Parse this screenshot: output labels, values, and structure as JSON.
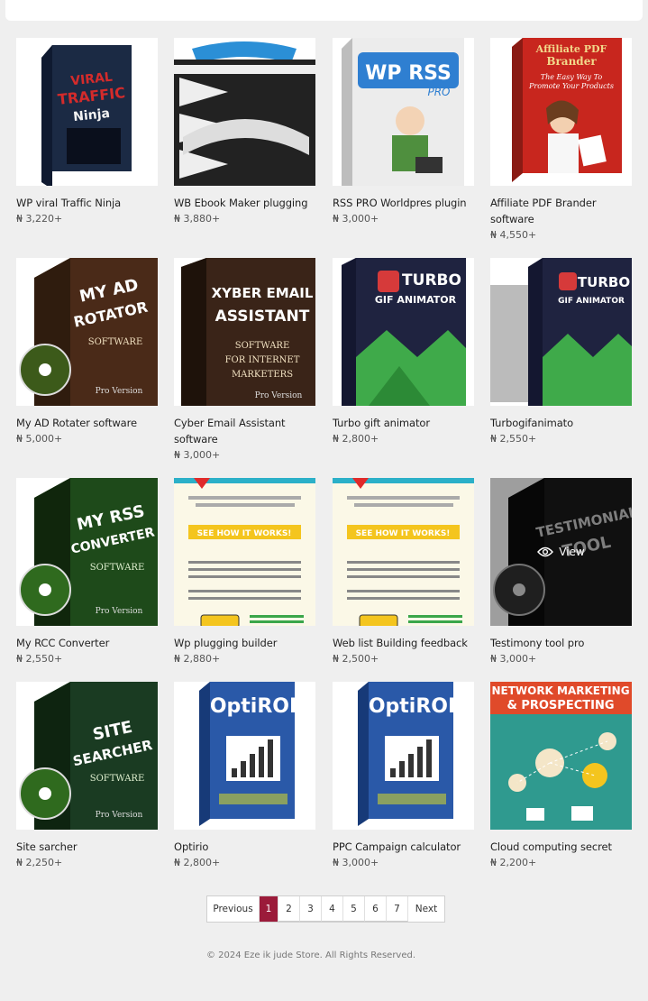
{
  "products": [
    {
      "title": "WP viral Traffic Ninja",
      "price": "₦ 3,220+",
      "cover_text": "VIRAL TRAFFIC Ninja",
      "cover_color": "#1b2a44",
      "accent": "#d42b2b"
    },
    {
      "title": "WB Ebook Maker plugging",
      "price": "₦ 3,880+",
      "cover_text": "",
      "cover_color": "#222222",
      "accent": "#2b8fd6"
    },
    {
      "title": "RSS PRO Worldpres plugin",
      "price": "₦ 3,000+",
      "cover_text": "WP RSS PRO",
      "cover_color": "#e8e8e8",
      "accent": "#2f7fd1"
    },
    {
      "title": "Affiliate PDF Brander software",
      "price": "₦ 4,550+",
      "cover_text": "Affiliate PDF Brander",
      "cover_color": "#c8261e",
      "accent": "#f2d98b"
    },
    {
      "title": "My AD Rotater software",
      "price": "₦ 5,000+",
      "cover_text": "MY AD ROTATOR",
      "cover_color": "#4a2a18",
      "accent": "#3c7a2a"
    },
    {
      "title": "Cyber Email Assistant software",
      "price": "₦ 3,000+",
      "cover_text": "XYBER EMAIL ASSISTANT",
      "cover_color": "#3a2418",
      "accent": "#f2f2f2"
    },
    {
      "title": "Turbo gift animator",
      "price": "₦ 2,800+",
      "cover_text": "TURBO GIF ANIMATOR",
      "cover_color": "#1f2340",
      "accent": "#3faa4a"
    },
    {
      "title": "Turbogifanimato",
      "price": "₦ 2,550+",
      "cover_text": "TURBO GIF ANIMATOR",
      "cover_color": "#1f2340",
      "accent": "#3faa4a"
    },
    {
      "title": "My RCC Converter",
      "price": "₦ 2,550+",
      "cover_text": "MY RSS CONVERTER",
      "cover_color": "#1e4a1a",
      "accent": "#66c23f"
    },
    {
      "title": "Wp plugging builder",
      "price": "₦ 2,880+",
      "cover_text": "SEE HOW IT WORKS!",
      "cover_color": "#fbf8e7",
      "accent": "#f4c51e"
    },
    {
      "title": "Web list Building feedback",
      "price": "₦ 2,500+",
      "cover_text": "SEE HOW IT WORKS!",
      "cover_color": "#fbf8e7",
      "accent": "#f4c51e"
    },
    {
      "title": "Testimony tool pro",
      "price": "₦ 3,000+",
      "cover_text": "TESTIMONIAL TOOL",
      "cover_color": "#1a1a1a",
      "accent": "#888888"
    },
    {
      "title": "Site sarcher",
      "price": "₦ 2,250+",
      "cover_text": "SITE SEARCHER",
      "cover_color": "#1a3b22",
      "accent": "#3b8a3e"
    },
    {
      "title": "Optirio",
      "price": "₦ 2,800+",
      "cover_text": "OptiROI",
      "cover_color": "#2a59a8",
      "accent": "#ffffff"
    },
    {
      "title": "PPC Campaign calculator",
      "price": "₦ 3,000+",
      "cover_text": "OptiROI",
      "cover_color": "#2a59a8",
      "accent": "#ffffff"
    },
    {
      "title": "Cloud computing secret",
      "price": "₦ 2,200+",
      "cover_text": "NETWORK MARKETING & PROSPECTING",
      "cover_color": "#2f9a8f",
      "accent": "#e04a2a"
    }
  ],
  "hover_overlay": {
    "label": "View"
  },
  "pagination": {
    "previous": "Previous",
    "next": "Next",
    "pages": [
      "1",
      "2",
      "3",
      "4",
      "5",
      "6",
      "7"
    ],
    "current": "1"
  },
  "footer": {
    "text": "© 2024 Eze ik jude Store. All Rights Reserved."
  },
  "colors": {
    "accent": "#9b1b3a",
    "background": "#efefef"
  }
}
